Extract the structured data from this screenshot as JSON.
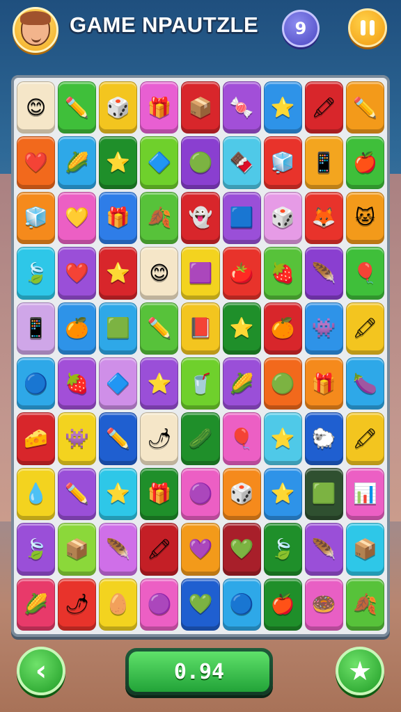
{
  "header": {
    "title": "GAME NPAUTZLE",
    "level": "9",
    "avatar_icon": "boy-face-icon",
    "pause_icon": "pause-icon"
  },
  "board": {
    "rows": 10,
    "cols": 9,
    "tiles": [
      [
        {
          "c": "#f5e6c8",
          "i": "😊",
          "n": "face"
        },
        {
          "c": "#3fbf3a",
          "i": "✏️",
          "n": "pencil"
        },
        {
          "c": "#f3c51f",
          "i": "🎲",
          "n": "dice"
        },
        {
          "c": "#e85fd2",
          "i": "🎁",
          "n": "gift-box"
        },
        {
          "c": "#d8262b",
          "i": "📦",
          "n": "box"
        },
        {
          "c": "#a24fd8",
          "i": "🍬",
          "n": "candy"
        },
        {
          "c": "#2e93e8",
          "i": "⭐",
          "n": "star"
        },
        {
          "c": "#d8262b",
          "i": "🖍",
          "n": "crayon"
        },
        {
          "c": "#f39a1a",
          "i": "✏️",
          "n": "pencil"
        }
      ],
      [
        {
          "c": "#f2691c",
          "i": "❤️",
          "n": "heart"
        },
        {
          "c": "#2ea8e8",
          "i": "🌽",
          "n": "corn"
        },
        {
          "c": "#1f8f2a",
          "i": "⭐",
          "n": "star"
        },
        {
          "c": "#6fd02c",
          "i": "🔷",
          "n": "block"
        },
        {
          "c": "#8a3fd0",
          "i": "🟢",
          "n": "slime"
        },
        {
          "c": "#4fc9e8",
          "i": "🍫",
          "n": "chocolate"
        },
        {
          "c": "#e8332b",
          "i": "🧊",
          "n": "cube"
        },
        {
          "c": "#f3a51f",
          "i": "📱",
          "n": "tablet"
        },
        {
          "c": "#3fbf3a",
          "i": "🍎",
          "n": "apple"
        }
      ],
      [
        {
          "c": "#f58a1c",
          "i": "🧊",
          "n": "cube"
        },
        {
          "c": "#ec5fc4",
          "i": "💛",
          "n": "heart"
        },
        {
          "c": "#2e7de8",
          "i": "🎁",
          "n": "gift-box"
        },
        {
          "c": "#57c23a",
          "i": "🍂",
          "n": "leaf"
        },
        {
          "c": "#d8262b",
          "i": "👻",
          "n": "ghost"
        },
        {
          "c": "#9a4fd8",
          "i": "🟦",
          "n": "cube"
        },
        {
          "c": "#e69be6",
          "i": "🎲",
          "n": "dice"
        },
        {
          "c": "#e8332b",
          "i": "🦊",
          "n": "fox"
        },
        {
          "c": "#f39a1a",
          "i": "🐱",
          "n": "cat"
        }
      ],
      [
        {
          "c": "#2ec7e8",
          "i": "🍃",
          "n": "leaf"
        },
        {
          "c": "#9a4fd8",
          "i": "❤️",
          "n": "heart"
        },
        {
          "c": "#d8262b",
          "i": "⭐",
          "n": "star"
        },
        {
          "c": "#f5e6c8",
          "i": "😊",
          "n": "face"
        },
        {
          "c": "#f3d31f",
          "i": "🟪",
          "n": "block"
        },
        {
          "c": "#e8332b",
          "i": "🍅",
          "n": "tomato"
        },
        {
          "c": "#57c23a",
          "i": "🍓",
          "n": "strawberry"
        },
        {
          "c": "#8a3fd0",
          "i": "🪶",
          "n": "feather"
        },
        {
          "c": "#3fbf3a",
          "i": "🎈",
          "n": "balloon"
        }
      ],
      [
        {
          "c": "#cfa6e8",
          "i": "📱",
          "n": "tablet"
        },
        {
          "c": "#2e93e8",
          "i": "🍊",
          "n": "orange"
        },
        {
          "c": "#2ea8e8",
          "i": "🟩",
          "n": "block"
        },
        {
          "c": "#57c23a",
          "i": "✏️",
          "n": "pencil"
        },
        {
          "c": "#f3c51f",
          "i": "📕",
          "n": "book"
        },
        {
          "c": "#1f8f2a",
          "i": "⭐",
          "n": "star"
        },
        {
          "c": "#d8262b",
          "i": "🍊",
          "n": "orange"
        },
        {
          "c": "#2e93e8",
          "i": "👾",
          "n": "monster"
        },
        {
          "c": "#f3c51f",
          "i": "🖍",
          "n": "crayon"
        }
      ],
      [
        {
          "c": "#2ea8e8",
          "i": "🔵",
          "n": "ball"
        },
        {
          "c": "#a24fd8",
          "i": "🍓",
          "n": "strawberry"
        },
        {
          "c": "#cf8fe8",
          "i": "🔷",
          "n": "block"
        },
        {
          "c": "#9a4fd8",
          "i": "⭐",
          "n": "star"
        },
        {
          "c": "#6fd02c",
          "i": "🥤",
          "n": "cup"
        },
        {
          "c": "#9a4fd8",
          "i": "🌽",
          "n": "corn"
        },
        {
          "c": "#f2691c",
          "i": "🟢",
          "n": "slime"
        },
        {
          "c": "#f58a1c",
          "i": "🎁",
          "n": "gift-box"
        },
        {
          "c": "#2ea8e8",
          "i": "🍆",
          "n": "eggplant"
        }
      ],
      [
        {
          "c": "#d8262b",
          "i": "🧀",
          "n": "wedge"
        },
        {
          "c": "#f3d31f",
          "i": "👾",
          "n": "monster"
        },
        {
          "c": "#1f5fd0",
          "i": "✏️",
          "n": "pencil"
        },
        {
          "c": "#f5e6c8",
          "i": "🌶",
          "n": "pepper"
        },
        {
          "c": "#1f8f2a",
          "i": "🥒",
          "n": "cucumber"
        },
        {
          "c": "#ec5fc4",
          "i": "🎈",
          "n": "balloon"
        },
        {
          "c": "#4fc9e8",
          "i": "⭐",
          "n": "star"
        },
        {
          "c": "#1f5fd0",
          "i": "🐑",
          "n": "sheep"
        },
        {
          "c": "#f3c51f",
          "i": "🖍",
          "n": "crayon"
        }
      ],
      [
        {
          "c": "#f3d31f",
          "i": "💧",
          "n": "drop"
        },
        {
          "c": "#9a4fd8",
          "i": "✏️",
          "n": "pencil"
        },
        {
          "c": "#2ec7e8",
          "i": "⭐",
          "n": "star"
        },
        {
          "c": "#1f8f2a",
          "i": "🎁",
          "n": "gift-box"
        },
        {
          "c": "#ec5fc4",
          "i": "🟣",
          "n": "ball"
        },
        {
          "c": "#f58a1c",
          "i": "🎲",
          "n": "dice"
        },
        {
          "c": "#2e93e8",
          "i": "⭐",
          "n": "star"
        },
        {
          "c": "#2f5030",
          "i": "🟩",
          "n": "block"
        },
        {
          "c": "#ec5fc4",
          "i": "📊",
          "n": "chart"
        }
      ],
      [
        {
          "c": "#9a4fd8",
          "i": "🍃",
          "n": "leaf"
        },
        {
          "c": "#8bd83a",
          "i": "📦",
          "n": "box"
        },
        {
          "c": "#cf6fe8",
          "i": "🪶",
          "n": "feather"
        },
        {
          "c": "#c41f26",
          "i": "🖍",
          "n": "crayon"
        },
        {
          "c": "#f39a1a",
          "i": "💜",
          "n": "heart"
        },
        {
          "c": "#a81f2a",
          "i": "💚",
          "n": "heart"
        },
        {
          "c": "#1f8f2a",
          "i": "🍃",
          "n": "leaf"
        },
        {
          "c": "#9a4fd8",
          "i": "🪶",
          "n": "feather"
        },
        {
          "c": "#2ec7e8",
          "i": "📦",
          "n": "box"
        }
      ],
      [
        {
          "c": "#e83a6a",
          "i": "🌽",
          "n": "corn"
        },
        {
          "c": "#e8332b",
          "i": "🌶",
          "n": "pepper"
        },
        {
          "c": "#f3d31f",
          "i": "🥚",
          "n": "egg"
        },
        {
          "c": "#ec5fc4",
          "i": "🟣",
          "n": "ball"
        },
        {
          "c": "#1f5fd0",
          "i": "💚",
          "n": "heart"
        },
        {
          "c": "#2ea8e8",
          "i": "🔵",
          "n": "ball"
        },
        {
          "c": "#1f8f2a",
          "i": "🍎",
          "n": "apple"
        },
        {
          "c": "#e85fc4",
          "i": "🍩",
          "n": "donut"
        },
        {
          "c": "#57c23a",
          "i": "🍂",
          "n": "leaf"
        }
      ]
    ]
  },
  "footer": {
    "back_icon": "chevron-left-icon",
    "back_glyph": "‹",
    "score": "0.94",
    "star_icon": "star-icon",
    "star_glyph": "★"
  }
}
